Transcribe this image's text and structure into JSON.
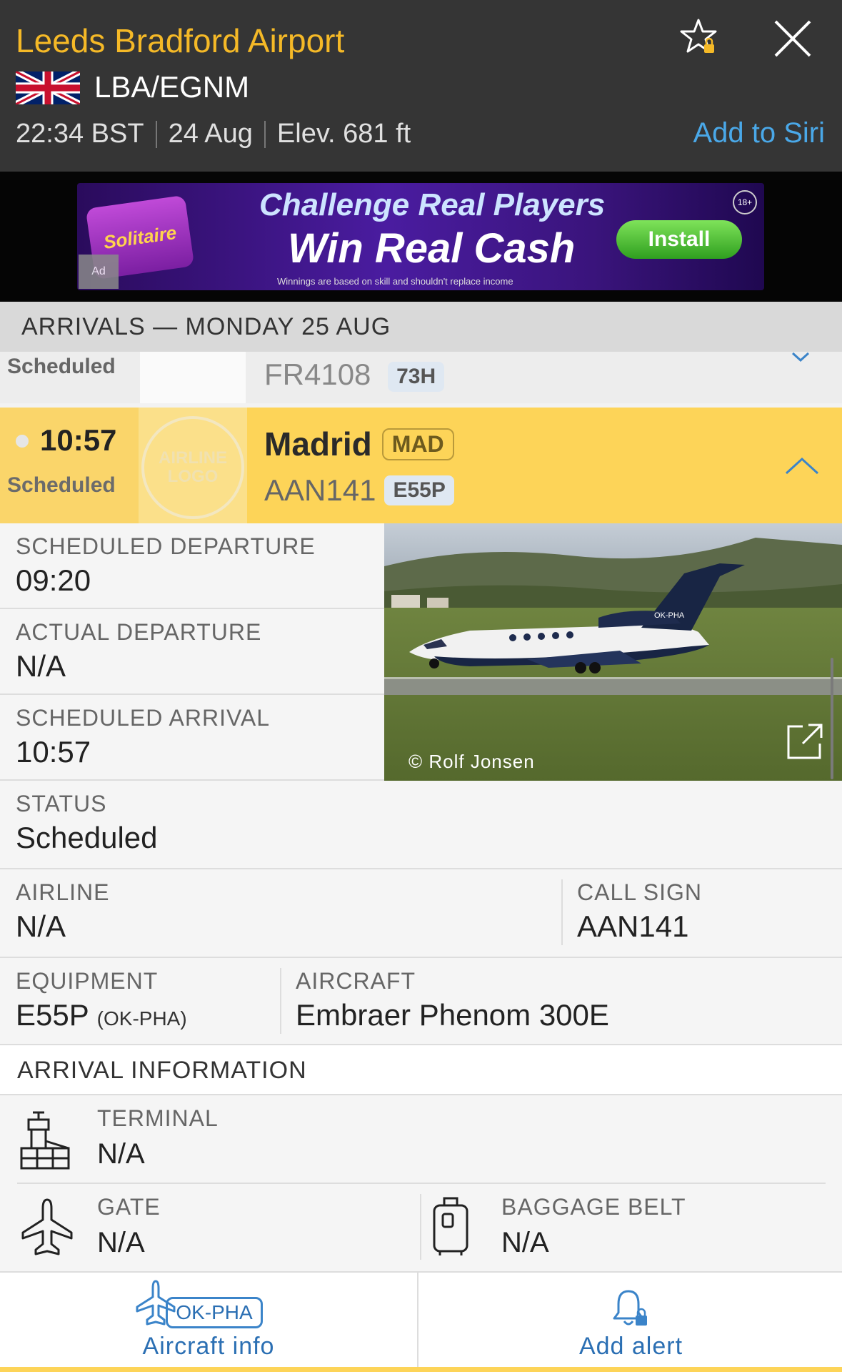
{
  "header": {
    "airport_name": "Leeds Bradford Airport",
    "codes": "LBA/EGNM",
    "time": "22:34 BST",
    "date": "24 Aug",
    "elevation": "Elev. 681 ft",
    "siri_label": "Add to Siri",
    "flag": "united-kingdom-flag",
    "icons": [
      "star-lock-icon",
      "close-icon"
    ]
  },
  "ad": {
    "brand": "Solitaire",
    "headline": "Challenge Real Players",
    "subheadline": "Win Real Cash",
    "fine_print": "Winnings are based on skill and shouldn't replace income",
    "install_label": "Install",
    "age_badge": "18+",
    "ad_badge": "Ad"
  },
  "section": {
    "title": "ARRIVALS — MONDAY 25 AUG"
  },
  "previous_flight": {
    "status": "Scheduled",
    "flight": "FR4108",
    "equipment": "73H"
  },
  "flight": {
    "time": "10:57",
    "status": "Scheduled",
    "logo_placeholder": "AIRLINE LOGO",
    "destination": "Madrid",
    "destination_code": "MAD",
    "flight_number": "AAN141",
    "equipment": "E55P",
    "highlight_color": "#fdd458"
  },
  "details": {
    "scheduled_departure": {
      "label": "SCHEDULED DEPARTURE",
      "value": "09:20"
    },
    "actual_departure": {
      "label": "ACTUAL DEPARTURE",
      "value": "N/A"
    },
    "scheduled_arrival": {
      "label": "SCHEDULED ARRIVAL",
      "value": "10:57"
    },
    "status": {
      "label": "STATUS",
      "value": "Scheduled"
    },
    "airline": {
      "label": "AIRLINE",
      "value": "N/A"
    },
    "call_sign": {
      "label": "CALL SIGN",
      "value": "AAN141"
    },
    "equipment": {
      "label": "EQUIPMENT",
      "value": "E55P",
      "registration": "(OK-PHA)"
    },
    "aircraft": {
      "label": "AIRCRAFT",
      "value": "Embraer Phenom 300E"
    },
    "photo_credit": "© Rolf Jonsen",
    "aircraft_tail": "OK-PHA"
  },
  "arrival_info": {
    "title": "ARRIVAL INFORMATION",
    "terminal": {
      "label": "TERMINAL",
      "value": "N/A"
    },
    "gate": {
      "label": "GATE",
      "value": "N/A"
    },
    "baggage": {
      "label": "BAGGAGE BELT",
      "value": "N/A"
    }
  },
  "bottom_bar": {
    "aircraft_info_label": "Aircraft info",
    "registration": "OK-PHA",
    "add_alert_label": "Add alert",
    "accent": "#2b6fb3"
  }
}
